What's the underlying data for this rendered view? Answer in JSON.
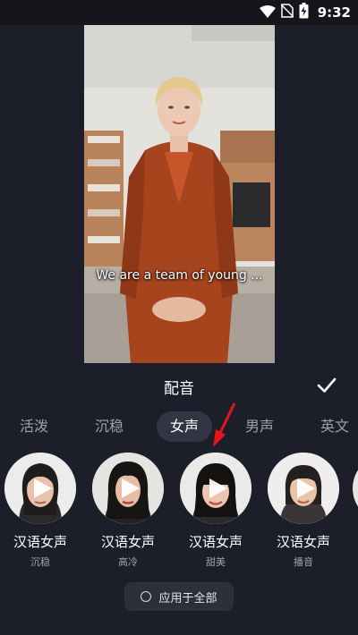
{
  "status_bar": {
    "time": "9:32",
    "icons": [
      "wifi-icon",
      "no-sim-icon",
      "battery-charging-icon"
    ]
  },
  "preview": {
    "subtitle": "We are a team of young ..."
  },
  "panel": {
    "title": "配音",
    "confirm_icon": "checkmark-icon"
  },
  "tabs": [
    {
      "label": "活泼",
      "active": false
    },
    {
      "label": "沉稳",
      "active": false
    },
    {
      "label": "女声",
      "active": true
    },
    {
      "label": "男声",
      "active": false
    },
    {
      "label": "英文",
      "active": false
    }
  ],
  "voices": [
    {
      "name": "汉语女声",
      "style": "沉稳",
      "icon": "play-icon"
    },
    {
      "name": "汉语女声",
      "style": "高冷",
      "icon": "play-icon"
    },
    {
      "name": "汉语女声",
      "style": "甜美",
      "icon": "play-icon"
    },
    {
      "name": "汉语女声",
      "style": "播音",
      "icon": "play-icon"
    }
  ],
  "apply_all": {
    "label": "应用于全部",
    "checked": false
  },
  "colors": {
    "background": "#1c1e29",
    "active_tab": "#323543",
    "annotation_arrow": "#e8141c"
  }
}
